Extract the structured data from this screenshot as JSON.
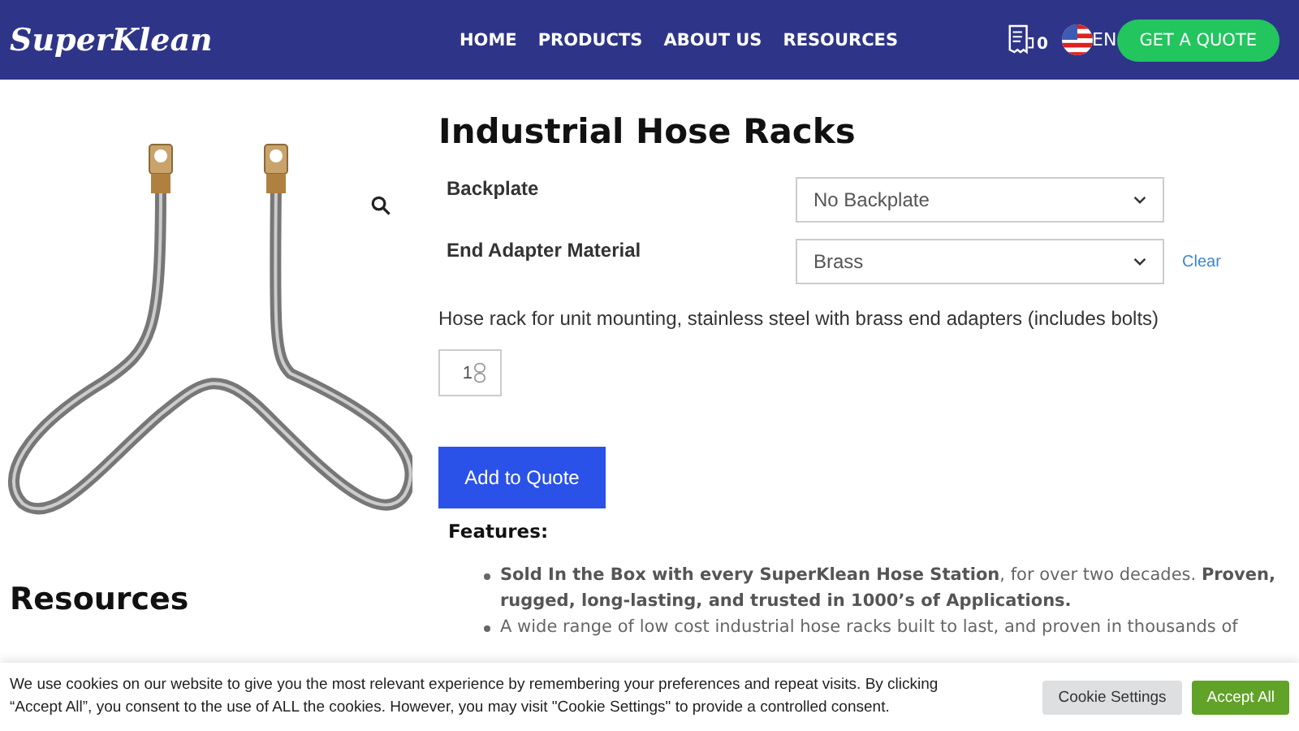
{
  "header": {
    "logo": "SuperKlean",
    "nav": [
      {
        "label": "HOME"
      },
      {
        "label": "PRODUCTS"
      },
      {
        "label": "ABOUT US"
      },
      {
        "label": "RESOURCES"
      }
    ],
    "quote_count": "0",
    "language": "EN",
    "cta": "GET A QUOTE"
  },
  "product": {
    "title": "Industrial Hose Racks",
    "options": [
      {
        "label": "Backplate",
        "value": "No Backplate"
      },
      {
        "label": "End Adapter Material",
        "value": "Brass",
        "clear": "Clear"
      }
    ],
    "description": "Hose rack for unit mounting, stainless steel with brass end adapters (includes bolts)",
    "quantity": "1",
    "add_button": "Add to Quote",
    "features_heading": "Features:",
    "features": [
      "**Sold In the Box with every SuperKlean Hose Station**, for over two decades. **Proven, rugged, long-lasting, and trusted in 1000’s of Applications.**",
      "A wide range of low cost industrial hose racks built to last, and proven in thousands of"
    ]
  },
  "sidebar": {
    "heading": "Resources"
  },
  "cookie_banner": {
    "text": "We use cookies on our website to give you the most relevant experience by remembering your preferences and repeat visits. By clicking “Accept All”, you consent to the use of ALL the cookies. However, you may visit \"Cookie Settings\" to provide a controlled consent.",
    "settings_button": "Cookie Settings",
    "accept_button": "Accept All"
  }
}
